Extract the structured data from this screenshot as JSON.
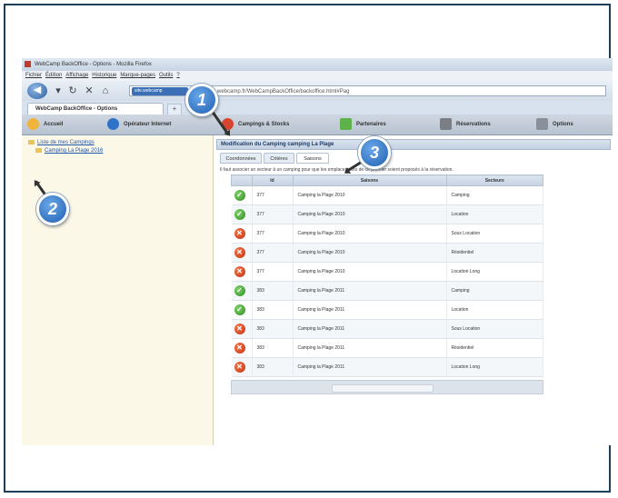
{
  "window": {
    "title": "WebCamp BackOffice - Options - Mozilla Firefox"
  },
  "menu": [
    "Fichier",
    "Édition",
    "Affichage",
    "Historique",
    "Marque-pages",
    "Outils",
    "?"
  ],
  "nav": {
    "url": "http://site.webcamp.fr/WebCampBackOffice/backoffice.html#Pag",
    "site_badge": "site.webcamp"
  },
  "browser_tab": {
    "label": "WebCamp BackOffice - Options",
    "new_tab": "+"
  },
  "toolbar": {
    "items": [
      {
        "label": "Accueil",
        "color": "#f0b43a"
      },
      {
        "label": "Opérateur Internet",
        "color": "#2f73c9"
      },
      {
        "label": "Campings & Stocks",
        "color": "#d8452e"
      },
      {
        "label": "Partenaires",
        "color": "#5db34a"
      },
      {
        "label": "Réservations",
        "color": "#7a7f86"
      },
      {
        "label": "Options",
        "color": "#8a9099"
      }
    ]
  },
  "tree": {
    "root": "Liste de mes Campings",
    "child": "Camping La Plage 2016"
  },
  "panel": {
    "title": "Modification du Camping camping La Plage",
    "subtabs": [
      "Coordonnées",
      "Critères",
      "Saisons"
    ],
    "active_subtab": 2,
    "help": "Il faut associer un secteur à un camping pour que les emplacements de ce premier soient proposés à la réservation."
  },
  "grid": {
    "headers": [
      "",
      "Id",
      "Saisons",
      "Secteurs"
    ],
    "rows": [
      {
        "status": "ok",
        "id": "377",
        "saison": "Camping la Plage 2010",
        "secteur": "Camping"
      },
      {
        "status": "ok",
        "id": "377",
        "saison": "Camping la Plage 2010",
        "secteur": "Location"
      },
      {
        "status": "no",
        "id": "377",
        "saison": "Camping la Plage 2010",
        "secteur": "Sous Location"
      },
      {
        "status": "no",
        "id": "377",
        "saison": "Camping la Plage 2010",
        "secteur": "Résidentiel"
      },
      {
        "status": "no",
        "id": "377",
        "saison": "Camping la Plage 2010",
        "secteur": "Location Long"
      },
      {
        "status": "ok",
        "id": "383",
        "saison": "Camping la Plage 2011",
        "secteur": "Camping"
      },
      {
        "status": "ok",
        "id": "383",
        "saison": "Camping la Plage 2011",
        "secteur": "Location"
      },
      {
        "status": "no",
        "id": "383",
        "saison": "Camping la Plage 2011",
        "secteur": "Sous Location"
      },
      {
        "status": "no",
        "id": "383",
        "saison": "Camping la Plage 2011",
        "secteur": "Résidentiel"
      },
      {
        "status": "no",
        "id": "383",
        "saison": "Camping la Plage 2011",
        "secteur": "Location Long"
      }
    ]
  },
  "callouts": [
    "1",
    "2",
    "3"
  ]
}
